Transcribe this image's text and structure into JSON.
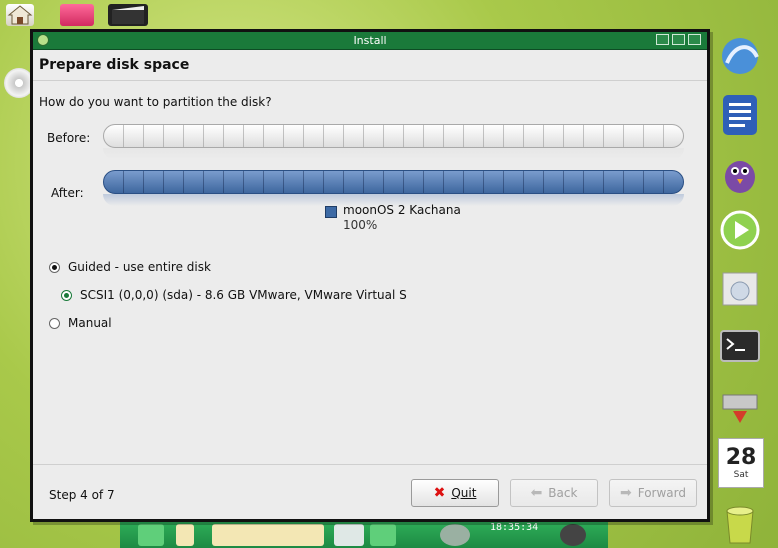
{
  "window": {
    "title": "Install",
    "header": "Prepare disk space",
    "question": "How do you want to partition the disk?"
  },
  "partition": {
    "before_label": "Before:",
    "after_label": "After:",
    "legend_name": "moonOS 2 Kachana",
    "legend_percent": "100%",
    "legend_color": "#3d6aa5"
  },
  "options": {
    "guided_label": "Guided - use entire disk",
    "disk_label": "SCSI1 (0,0,0) (sda) - 8.6 GB VMware, VMware Virtual S",
    "manual_label": "Manual",
    "selected": "guided"
  },
  "footer": {
    "step": "Step 4 of 7",
    "quit_label": "Quit",
    "back_label": "Back",
    "forward_label": "Forward"
  },
  "taskbar": {
    "clock_time": "18:35:34"
  },
  "dock": {
    "calendar_day": "28",
    "calendar_weekday": "Sat"
  },
  "colors": {
    "titlebar": "#1a7a3a",
    "taskbar": "#2fb05a",
    "desktop": "#a9c94a"
  }
}
